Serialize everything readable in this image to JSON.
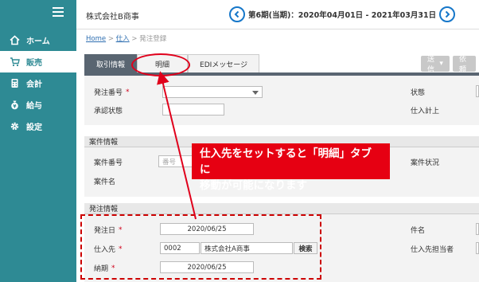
{
  "sidebar": {
    "items": [
      {
        "label": "ホーム",
        "icon": "home-icon"
      },
      {
        "label": "販売",
        "icon": "cart-icon"
      },
      {
        "label": "会計",
        "icon": "calculator-icon"
      },
      {
        "label": "給与",
        "icon": "money-bag-icon"
      },
      {
        "label": "設定",
        "icon": "gear-icon"
      }
    ]
  },
  "header": {
    "company": "株式会社B商事",
    "period": "第6期(当期)：2020年04月01日 - 2021年03月31日"
  },
  "breadcrumb": {
    "home": "Home",
    "sep1": ">",
    "purchase": "仕入",
    "sep2": ">",
    "current": "発注登録"
  },
  "tabs": [
    {
      "label": "取引情報",
      "active": true
    },
    {
      "label": "明細",
      "active": false
    },
    {
      "label": "EDIメッセージ",
      "active": false
    }
  ],
  "actions": {
    "send": "送信",
    "more": "依頼"
  },
  "order": {
    "order_no_label": "発注番号",
    "approval_label": "承認状態",
    "status_label": "状態",
    "purchase_total_label": "仕入計上"
  },
  "project": {
    "section": "案件情報",
    "project_no_label": "案件番号",
    "project_no_placeholder": "番号",
    "project_name_label": "案件名",
    "project_status_label": "案件状況"
  },
  "ordering": {
    "section": "発注情報",
    "order_date_label": "発注日",
    "order_date": "2020/06/25",
    "supplier_label": "仕入先",
    "supplier_code": "0002",
    "supplier_name": "株式会社A商事",
    "search_button": "検索",
    "due_label": "納期",
    "due_date": "2020/06/25",
    "subject_label": "件名",
    "supplier_contact_label": "仕入先担当者"
  },
  "required_mark": "*",
  "annotation": {
    "line1": "仕入先をセットすると「明細」タブに",
    "line2": "移動が可能になります"
  },
  "colors": {
    "sidebar": "#2e8a94",
    "tab_active": "#596571",
    "annotation": "#e60012",
    "accent_blue": "#1677c9"
  }
}
